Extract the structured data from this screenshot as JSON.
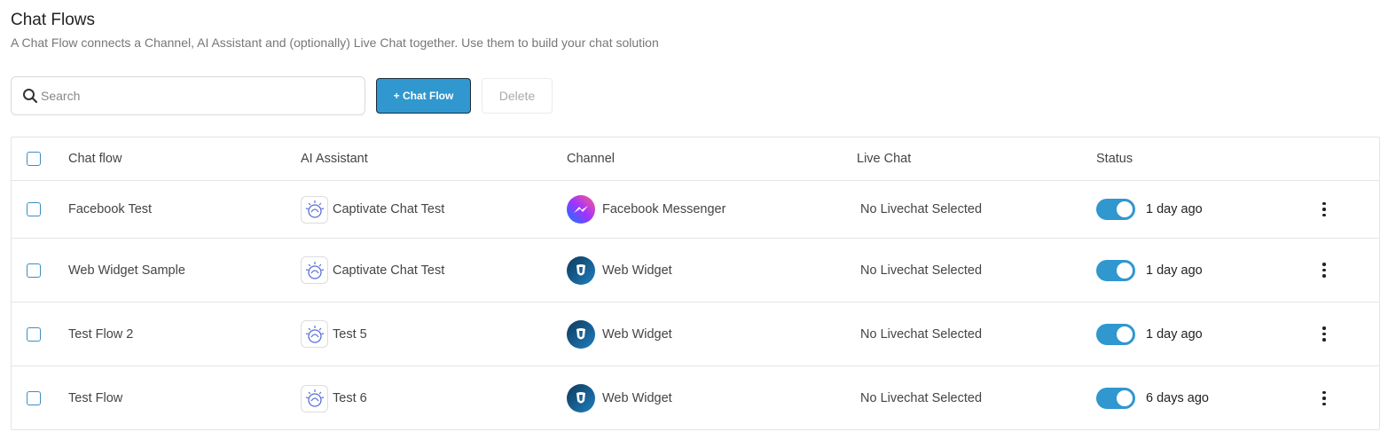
{
  "header": {
    "title": "Chat Flows",
    "subtitle": "A Chat Flow connects a Channel, AI Assistant and (optionally) Live Chat together. Use them to build your chat solution"
  },
  "toolbar": {
    "search_placeholder": "Search",
    "search_value": "",
    "add_label": "+ Chat Flow",
    "delete_label": "Delete"
  },
  "table": {
    "columns": [
      "Chat flow",
      "AI Assistant",
      "Channel",
      "Live Chat",
      "Status"
    ],
    "rows": [
      {
        "name": "Facebook Test",
        "assistant": "Captivate Chat Test",
        "channel": "Facebook Messenger",
        "channel_icon": "messenger-icon",
        "live_chat": "No Livechat Selected",
        "status_on": true,
        "status_time": "1 day ago"
      },
      {
        "name": "Web Widget Sample",
        "assistant": "Captivate Chat Test",
        "channel": "Web Widget",
        "channel_icon": "web-widget-icon",
        "live_chat": "No Livechat Selected",
        "status_on": true,
        "status_time": "1 day ago"
      },
      {
        "name": "Test Flow 2",
        "assistant": "Test 5",
        "channel": "Web Widget",
        "channel_icon": "web-widget-icon",
        "live_chat": "No Livechat Selected",
        "status_on": true,
        "status_time": "1 day ago"
      },
      {
        "name": "Test Flow",
        "assistant": "Test 6",
        "channel": "Web Widget",
        "channel_icon": "web-widget-icon",
        "live_chat": "No Livechat Selected",
        "status_on": true,
        "status_time": "6 days ago"
      }
    ]
  },
  "colors": {
    "accent": "#3097cf",
    "border": "#e4e4e4",
    "checkbox": "#3a8fc4"
  }
}
